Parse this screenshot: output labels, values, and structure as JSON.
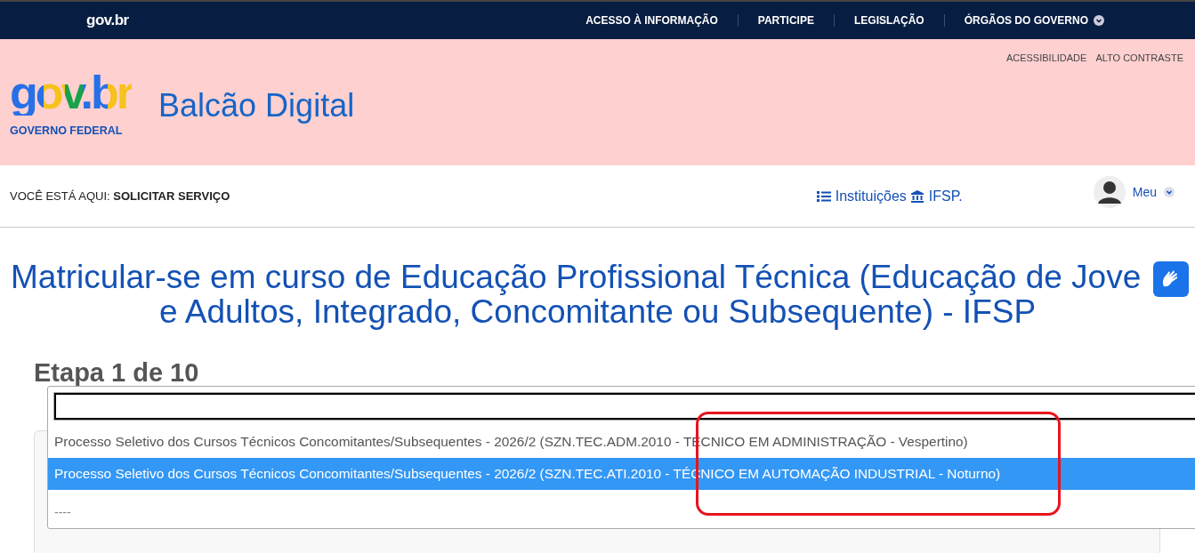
{
  "top_bar": {
    "logo": "gov.br",
    "links": [
      {
        "label": "ACESSO À INFORMAÇÃO",
        "dropdown": false
      },
      {
        "label": "PARTICIPE",
        "dropdown": false
      },
      {
        "label": "LEGISLAÇÃO",
        "dropdown": false
      },
      {
        "label": "ÓRGÃOS DO GOVERNO",
        "dropdown": true
      }
    ]
  },
  "header": {
    "logo": "gov.br",
    "logo_caption": "GOVERNO FEDERAL",
    "site_title": "Balcão Digital",
    "accessibility_links": [
      "ACESSIBILIDADE",
      "ALTO CONTRASTE"
    ]
  },
  "breadcrumb": {
    "text": "VOCÊ ESTÁ AQUI: **SOLICITAR SERVIÇO**",
    "links": [
      {
        "label": "Instituições"
      },
      {
        "label": "IFSP."
      }
    ],
    "user_menu": "Meu"
  },
  "page_title": [
    "Matricular-se em curso de Educação Profissional Técnica (Educação de Jove",
    "e Adultos, Integrado, Concomitante ou Subsequente) - IFSP"
  ],
  "step_heading": "Etapa 1 de 10",
  "dropdown": {
    "options": [
      {
        "label": "Processo Seletivo dos Cursos Técnicos Concomitantes/Subsequentes - 2026/2 (SZN.TEC.ADM.2010 - TÉCNICO EM ADMINISTRAÇÃO - Vespertino)",
        "selected": false,
        "kind": "option"
      },
      {
        "label": "Processo Seletivo dos Cursos Técnicos Concomitantes/Subsequentes - 2026/2 (SZN.TEC.ATI.2010 - TÉCNICO EM AUTOMAÇÃO INDUSTRIAL - Noturno)",
        "selected": true,
        "kind": "option"
      },
      {
        "label": "----",
        "selected": false,
        "kind": "placeholder"
      }
    ]
  }
}
